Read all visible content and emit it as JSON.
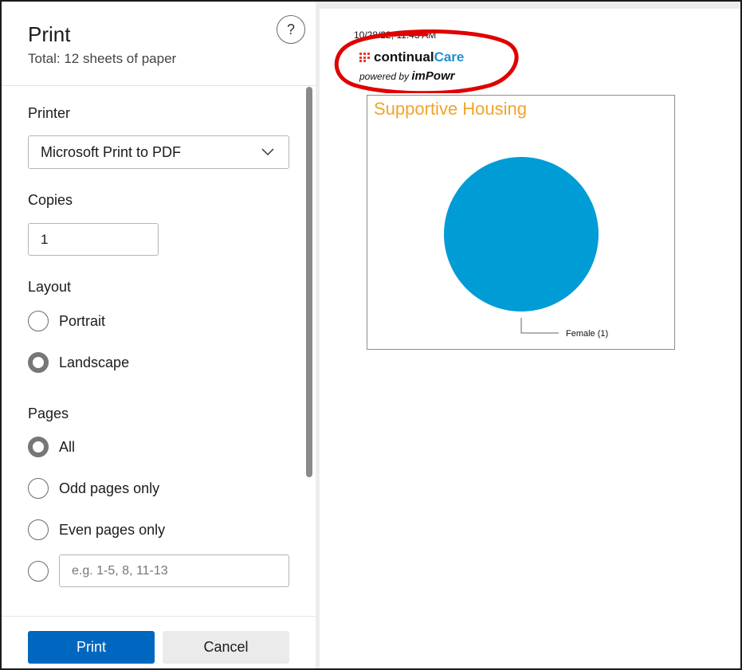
{
  "dialog": {
    "title": "Print",
    "subtitle": "Total: 12 sheets of paper",
    "help_label": "?"
  },
  "printer": {
    "label": "Printer",
    "selected": "Microsoft Print to PDF"
  },
  "copies": {
    "label": "Copies",
    "value": "1"
  },
  "layout": {
    "label": "Layout",
    "options": [
      {
        "label": "Portrait",
        "checked": false
      },
      {
        "label": "Landscape",
        "checked": true
      }
    ]
  },
  "pages": {
    "label": "Pages",
    "options": [
      {
        "label": "All",
        "checked": true
      },
      {
        "label": "Odd pages only",
        "checked": false
      },
      {
        "label": "Even pages only",
        "checked": false
      }
    ],
    "custom_placeholder": "e.g. 1-5, 8, 11-13"
  },
  "footer": {
    "print_label": "Print",
    "cancel_label": "Cancel"
  },
  "preview": {
    "timestamp": "10/28/22, 11:43 AM",
    "logo": {
      "brand_part1": "continual",
      "brand_part2": "Care",
      "tagline_prefix": "powered by",
      "tagline_brand": "imPowr"
    }
  },
  "chart_data": {
    "type": "pie",
    "title": "Supportive Housing",
    "categories": [
      "Female"
    ],
    "values": [
      1
    ],
    "labels": [
      "Female (1)"
    ],
    "colors": [
      "#009cd6"
    ]
  },
  "colors": {
    "accent": "#0067c0",
    "chart_title": "#f2a42a",
    "annotation": "#e00000"
  }
}
